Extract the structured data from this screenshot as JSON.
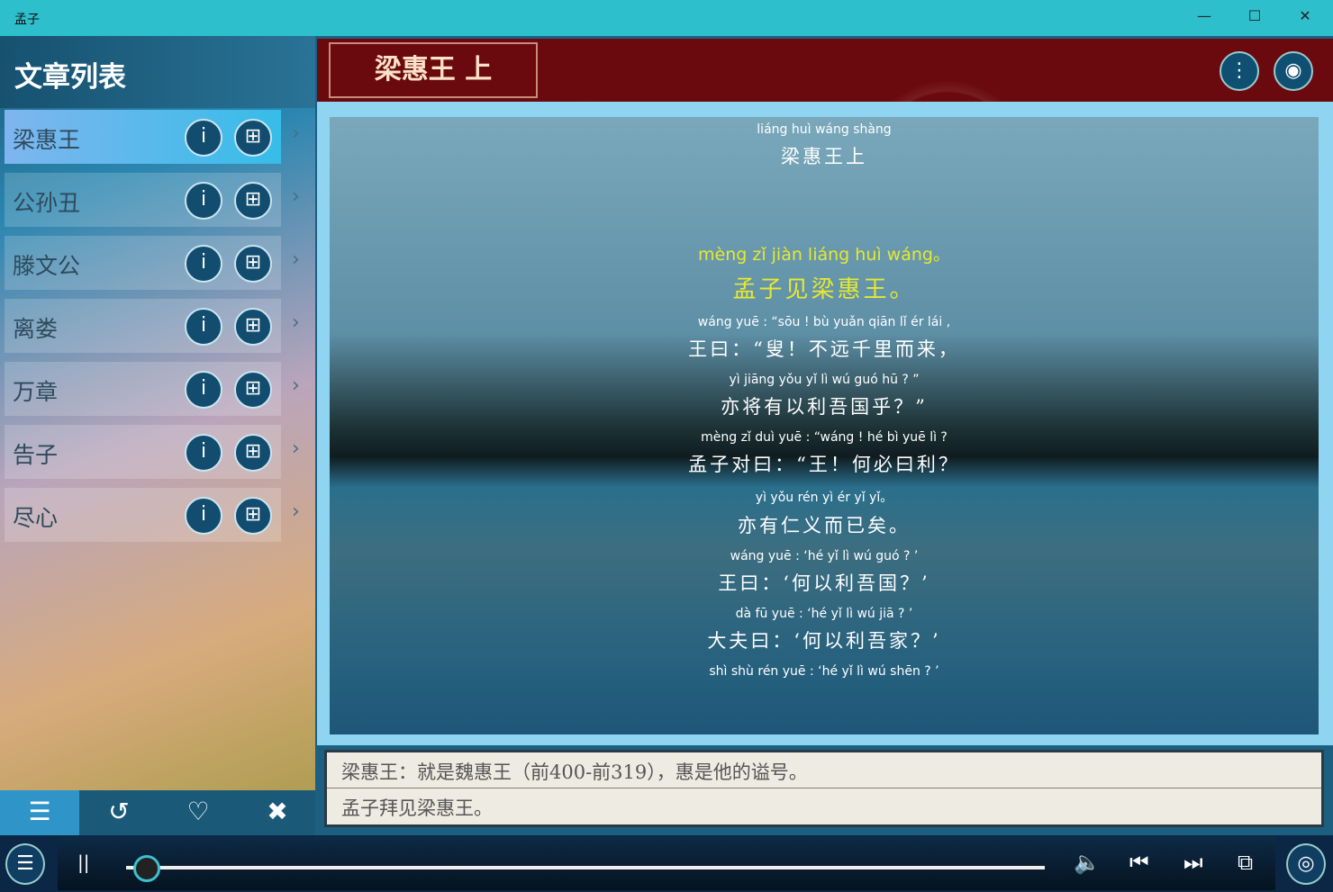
{
  "window": {
    "title": "孟子",
    "minimize": "—",
    "maximize": "☐",
    "close": "✕"
  },
  "sidebar": {
    "title": "文章列表",
    "items": [
      {
        "label": "梁惠王"
      },
      {
        "label": "公孙丑"
      },
      {
        "label": "滕文公"
      },
      {
        "label": "离娄"
      },
      {
        "label": "万章"
      },
      {
        "label": "告子"
      },
      {
        "label": "尽心"
      }
    ],
    "info_glyph": "i",
    "add_glyph": "⊞",
    "chevron": "›",
    "nav": [
      {
        "icon": "list-icon",
        "glyph": "☰"
      },
      {
        "icon": "history-icon",
        "glyph": "↺"
      },
      {
        "icon": "heart-icon",
        "glyph": "♡"
      },
      {
        "icon": "tools-icon",
        "glyph": "✖"
      }
    ]
  },
  "header": {
    "title": "梁惠王 上",
    "more_glyph": "⋮",
    "eye_glyph": "◉"
  },
  "text": {
    "title_pinyin": "liáng huì wáng shàng",
    "title_zh": "梁惠王上",
    "lines": [
      {
        "py": "mèng zǐ jiàn liáng huì wáng。",
        "zh": "孟子见梁惠王。",
        "highlight": true
      },
      {
        "py": "wáng yuē : “sōu ! bù yuǎn qiān lǐ ér lái ,",
        "zh": "王曰：“叟！不远千里而来，"
      },
      {
        "py": "yì jiāng yǒu yǐ lì wú guó hū ? ”",
        "zh": "亦将有以利吾国乎？”"
      },
      {
        "py": "mèng zǐ duì yuē : “wáng ! hé bì yuē lì ?",
        "zh": "孟子对曰：“王！何必曰利？"
      },
      {
        "py": "yì yǒu rén yì ér yǐ yǐ。",
        "zh": "亦有仁义而已矣。"
      },
      {
        "py": "wáng yuē : ‘hé yǐ lì wú guó ? ’",
        "zh": "王曰：‘何以利吾国？’"
      },
      {
        "py": "dà fū yuē : ‘hé yǐ lì wú jiā ? ’",
        "zh": "大夫曰：‘何以利吾家？’"
      },
      {
        "py": "shì shù rén yuē : ‘hé yǐ lì wú shēn ? ’",
        "zh": ""
      }
    ],
    "highlight_color": "#e8e830"
  },
  "notes": [
    "梁惠王：就是魏惠王（前400-前319），惠是他的谥号。",
    "孟子拜见梁惠王。"
  ],
  "player": {
    "menu": "☰",
    "pause": "||",
    "volume": "🔈",
    "prev": "⏮",
    "next": "⏭",
    "cast": "⧉",
    "music": "◎",
    "progress": 0.02
  }
}
